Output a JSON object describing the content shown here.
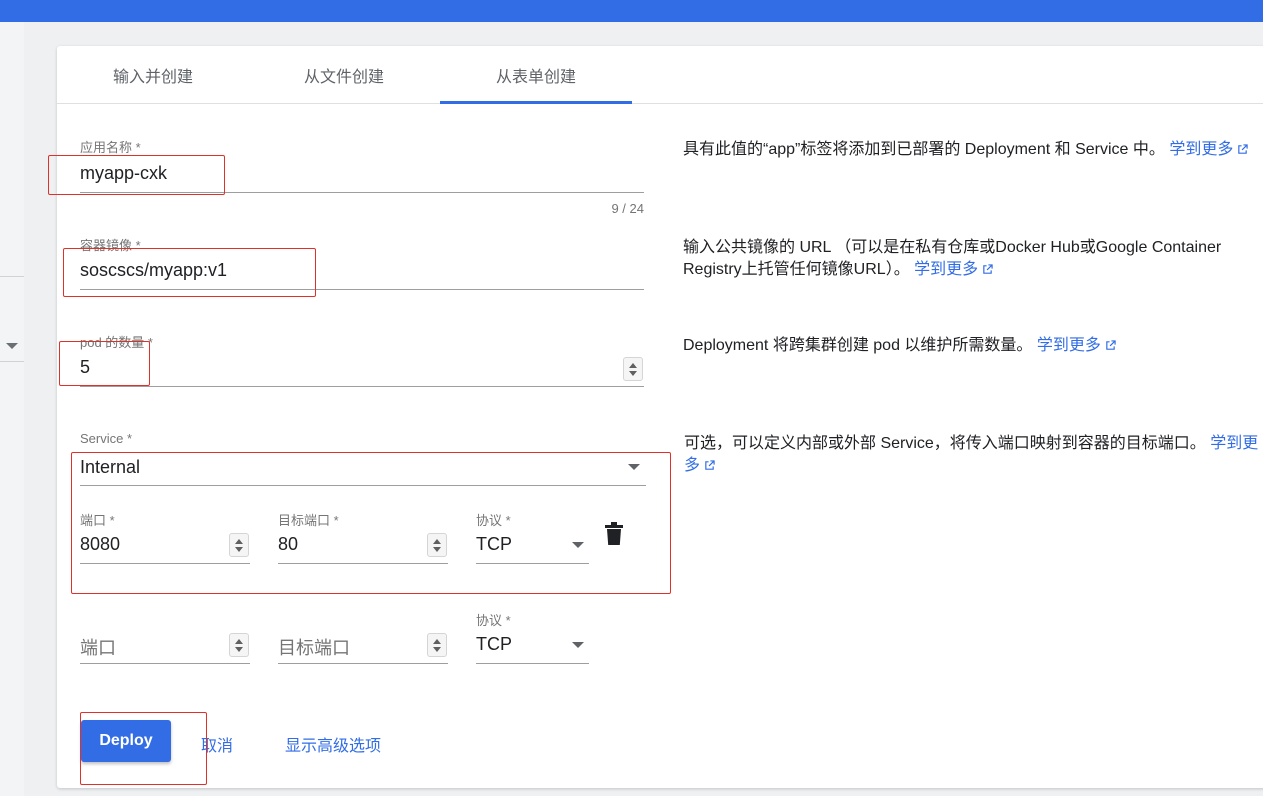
{
  "tabs": [
    {
      "label": "输入并创建"
    },
    {
      "label": "从文件创建"
    },
    {
      "label": "从表单创建",
      "active": true
    }
  ],
  "form": {
    "app_name": {
      "label": "应用名称 *",
      "value": "myapp-cxk",
      "counter": "9 / 24"
    },
    "image": {
      "label": "容器镜像 *",
      "value": "soscscs/myapp:v1"
    },
    "pods": {
      "label": "pod 的数量 *",
      "value": "5"
    },
    "service": {
      "label": "Service *",
      "value": "Internal"
    },
    "port_row_1": {
      "port": {
        "label": "端口 *",
        "value": "8080"
      },
      "target_port": {
        "label": "目标端口 *",
        "value": "80"
      },
      "protocol": {
        "label": "协议 *",
        "value": "TCP"
      }
    },
    "port_row_2": {
      "port": {
        "placeholder": "端口"
      },
      "target_port": {
        "placeholder": "目标端口"
      },
      "protocol": {
        "label": "协议 *",
        "value": "TCP"
      }
    }
  },
  "help": {
    "app_name": {
      "text": "具有此值的“app”标签将添加到已部署的 Deployment 和 Service 中。",
      "link": "学到更多"
    },
    "image": {
      "text": "输入公共镜像的 URL （可以是在私有仓库或Docker Hub或Google Container Registry上托管任何镜像URL）。",
      "link": "学到更多"
    },
    "pods": {
      "text": "Deployment 将跨集群创建 pod 以维护所需数量。",
      "link": "学到更多"
    },
    "service": {
      "text": "可选，可以定义内部或外部 Service，将传入端口映射到容器的目标端口。",
      "link": "学到更多"
    }
  },
  "actions": {
    "deploy": "Deploy",
    "cancel": "取消",
    "advanced": "显示高级选项"
  },
  "icons": {
    "delete": "trash-icon",
    "external": "external-link-icon",
    "dropdown": "chevron-down-icon"
  },
  "colors": {
    "primary": "#326de6",
    "highlight": "#e0302a"
  }
}
